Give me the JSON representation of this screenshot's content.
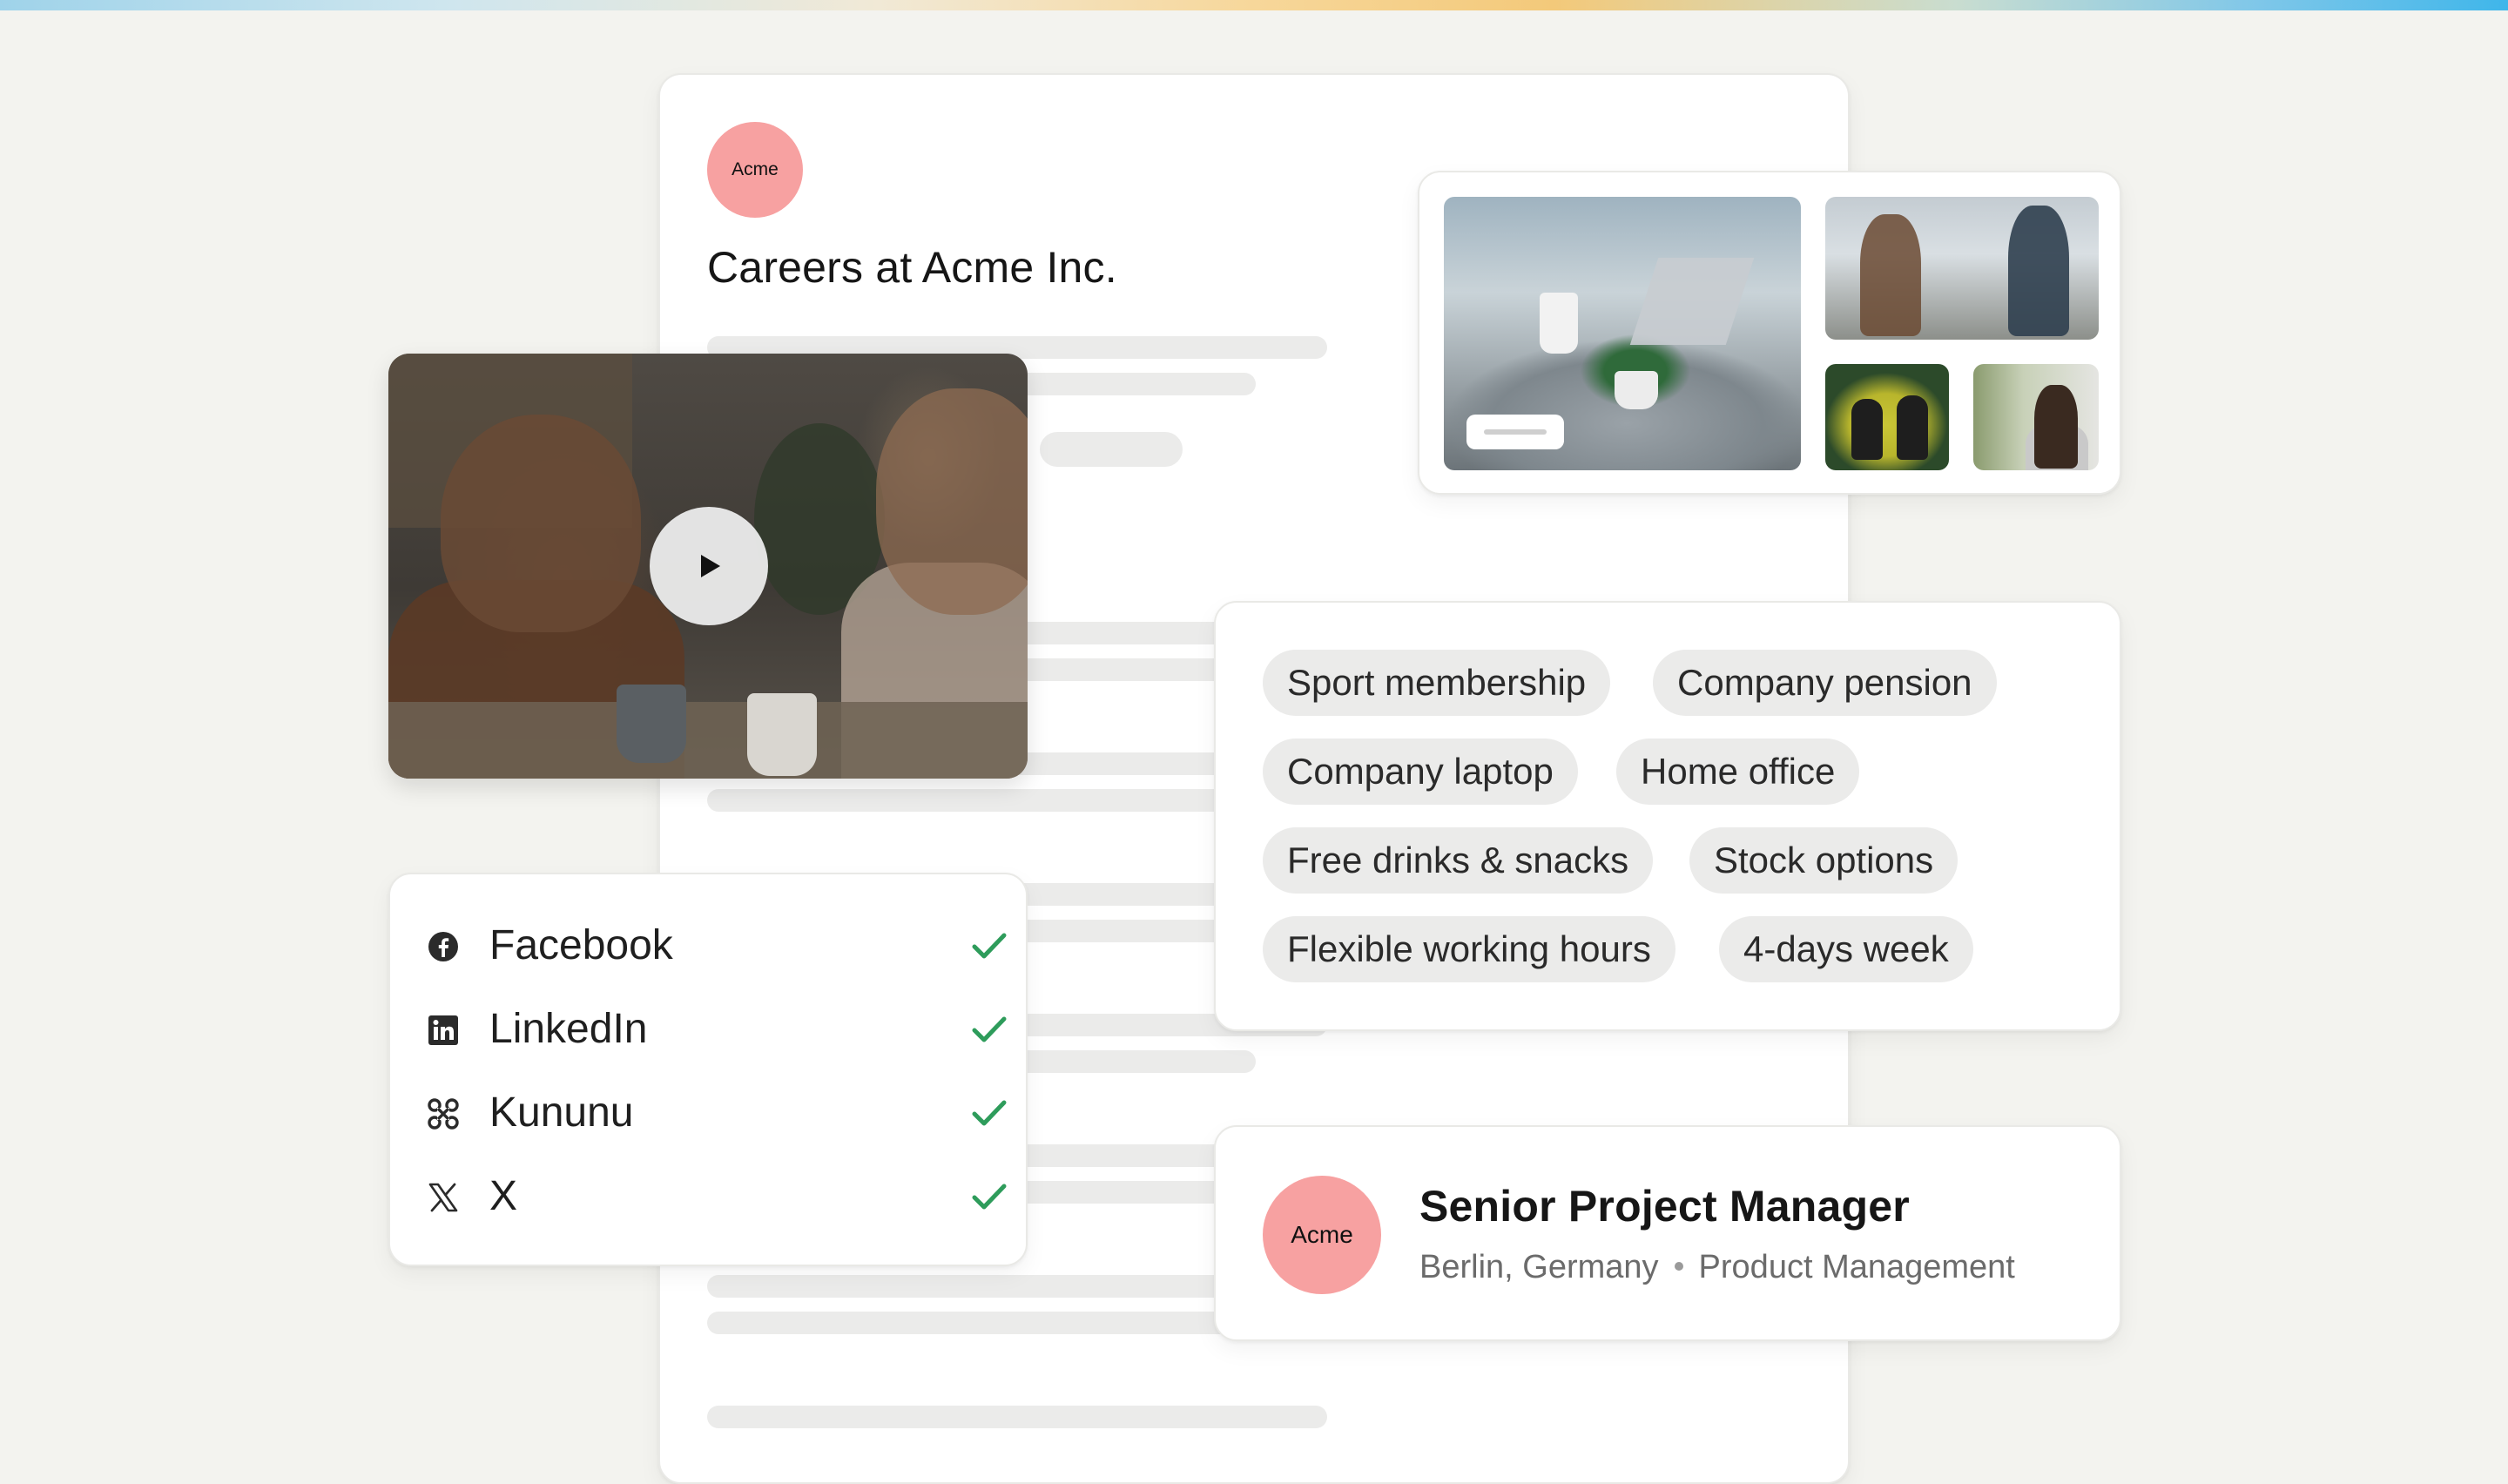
{
  "brand": {
    "logo_text": "Acme",
    "logo_color": "#f7a1a1",
    "accent_check_color": "#2e9c5b"
  },
  "careers_page": {
    "title": "Careers at Acme Inc."
  },
  "video": {
    "play_icon": "play-icon"
  },
  "benefits": {
    "tags": [
      "Sport membership",
      "Company pension",
      "Company laptop",
      "Home office",
      "Free drinks & snacks",
      "Stock options",
      "Flexible working hours",
      "4-days week"
    ]
  },
  "socials": {
    "items": [
      {
        "label": "Facebook",
        "icon": "facebook-icon",
        "checked": true
      },
      {
        "label": "LinkedIn",
        "icon": "linkedin-icon",
        "checked": true
      },
      {
        "label": "Kununu",
        "icon": "kununu-icon",
        "checked": true
      },
      {
        "label": "X",
        "icon": "x-icon",
        "checked": true
      }
    ]
  },
  "job": {
    "logo_text": "Acme",
    "title": "Senior Project Manager",
    "location": "Berlin, Germany",
    "department": "Product Management"
  }
}
